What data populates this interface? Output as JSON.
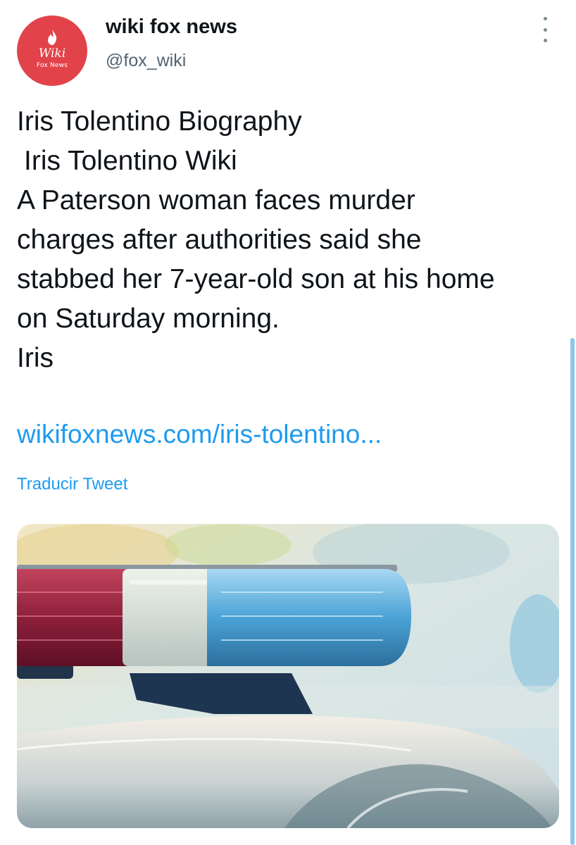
{
  "account": {
    "display_name": "wiki fox news",
    "handle": "@fox_wiki",
    "avatar": {
      "brand": "Wiki",
      "brand_sub": "Fox News",
      "color": "#e2434b"
    }
  },
  "tweet": {
    "lines": [
      "Iris Tolentino Biography",
      "Iris Tolentino Wiki",
      "A Paterson woman faces murder",
      "charges after authorities said she",
      "stabbed her 7-year-old son at his home",
      "on Saturday morning.",
      "Iris"
    ],
    "link": "wikifoxnews.com/iris-tolentino...",
    "translate_label": "Traducir Tweet"
  },
  "icons": {
    "more": "more-vertical-icon",
    "logo": "flame-icon"
  },
  "colors": {
    "link": "#1d9bf0",
    "text": "#0f1419",
    "secondary": "#536471"
  }
}
